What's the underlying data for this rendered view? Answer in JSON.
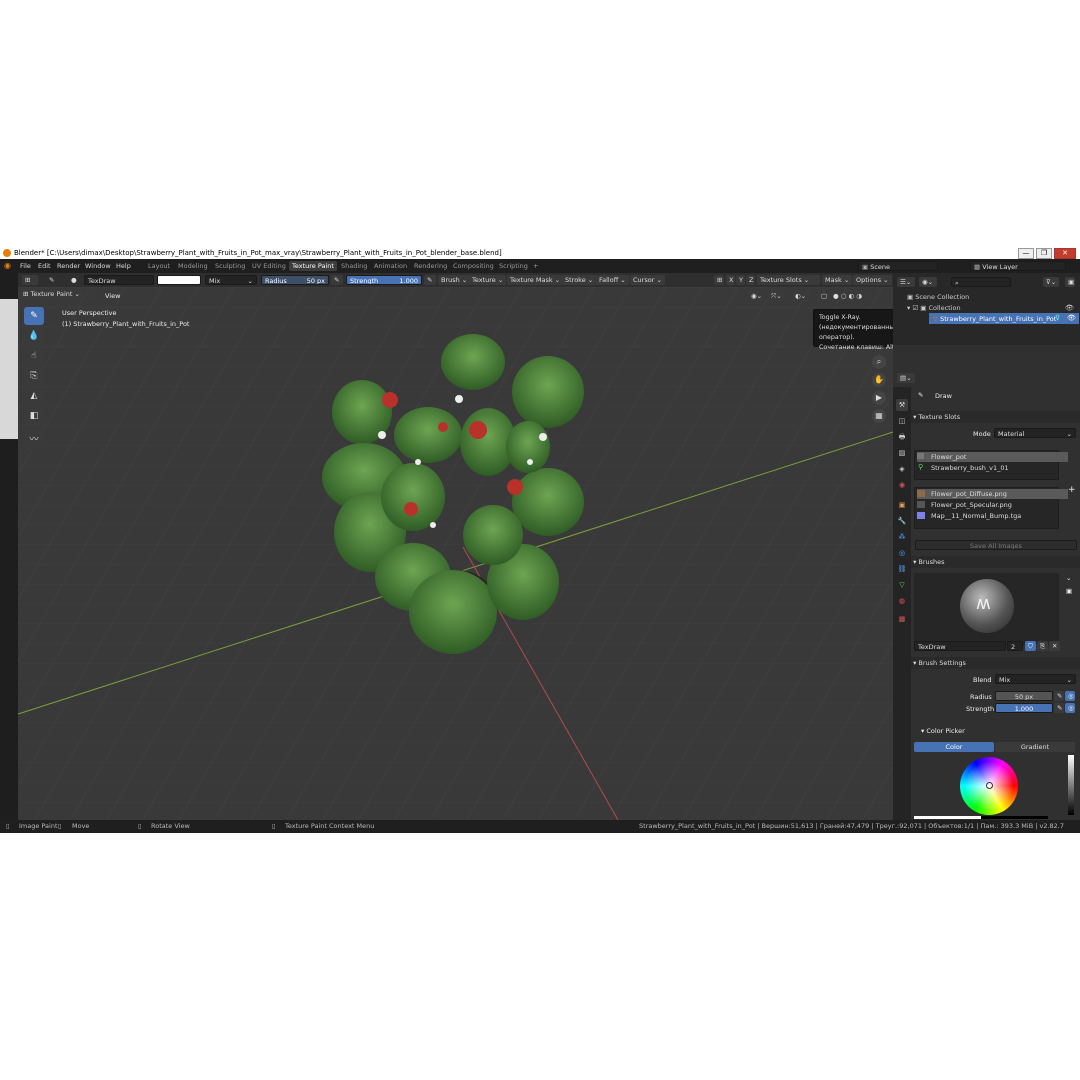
{
  "window": {
    "title": "Blender* [C:\\Users\\dimax\\Desktop\\Strawberry_Plant_with_Fruits_in_Pot_max_vray\\Strawberry_Plant_with_Fruits_in_Pot_blender_base.blend]",
    "min": "—",
    "max": "❐",
    "close": "✕"
  },
  "menu": {
    "items": [
      "File",
      "Edit",
      "Render",
      "Window",
      "Help"
    ],
    "workspaces": [
      "Layout",
      "Modeling",
      "Sculpting",
      "UV Editing",
      "Texture Paint",
      "Shading",
      "Animation",
      "Rendering",
      "Compositing",
      "Scripting"
    ],
    "active_workspace": "Texture Paint",
    "add_tab": "+",
    "scene": "Scene",
    "view_layer": "View Layer"
  },
  "toolheader": {
    "brush_name": "TexDraw",
    "blend": "Mix",
    "radius_label": "Radius",
    "radius_value": "50 px",
    "strength_label": "Strength",
    "strength_value": "1.000",
    "menus": [
      "Brush",
      "Texture",
      "Texture Mask",
      "Stroke",
      "Falloff",
      "Cursor"
    ],
    "axes": [
      "X",
      "Y",
      "Z"
    ],
    "texture_slots": "Texture Slots",
    "mask": "Mask",
    "options": "Options"
  },
  "viewport": {
    "mode": "Texture Paint",
    "view_menu": "View",
    "perspective": "User Perspective",
    "object": "(1) Strawberry_Plant_with_Fruits_in_Pot"
  },
  "tooltip": {
    "line1": "Toggle X-Ray.",
    "line2": "(недокументированный оператор).",
    "line3": "Сочетание клавиш: Alt Z"
  },
  "outliner": {
    "scene_collection": "Scene Collection",
    "collection": "Collection",
    "object": "Strawberry_Plant_with_Fruits_in_Pot"
  },
  "properties": {
    "tool_name": "Draw",
    "texture_slots_title": "Texture Slots",
    "mode_label": "Mode",
    "mode_value": "Material",
    "materials": [
      "Flower_pot",
      "Strawberry_bush_v1_01"
    ],
    "images": [
      "Flower_pot_Diffuse.png",
      "Flower_pot_Specular.png",
      "Map__11_Normal_Bump.tga"
    ],
    "save_all": "Save All Images",
    "brushes_title": "Brushes",
    "brush_name": "TexDraw",
    "brush_users": "2",
    "brush_settings_title": "Brush Settings",
    "blend_label": "Blend",
    "blend_value": "Mix",
    "radius_label": "Radius",
    "radius_value": "50 px",
    "strength_label": "Strength",
    "strength_value": "1.000",
    "color_picker_title": "Color Picker",
    "color_tab": "Color",
    "gradient_tab": "Gradient"
  },
  "statusbar": {
    "image_paint": "Image Paint",
    "move": "Move",
    "rotate": "Rotate View",
    "context": "Texture Paint Context Menu",
    "stats": "Strawberry_Plant_with_Fruits_in_Pot | Вершин:51,613 | Граней:47,479 | Треуг.:92,071 | Объектов:1/1 | Пам.: 393.3 MiB | v2.82.7"
  },
  "colors": {
    "accent": "#4772b3",
    "viewport_bg": "#3a3a3a",
    "axis_x": "#b34a4a",
    "axis_y": "#7aa23c",
    "leaf": "#4f8a3e",
    "berry": "#b8312a"
  }
}
